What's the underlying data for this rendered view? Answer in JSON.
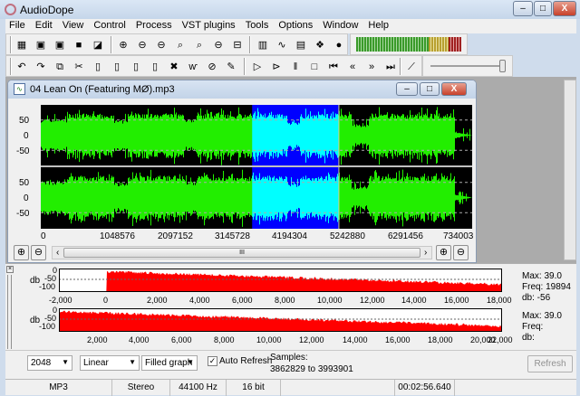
{
  "app": {
    "title": "AudioDope",
    "minimize": "–",
    "maximize": "□",
    "close": "X"
  },
  "menu": [
    "File",
    "Edit",
    "View",
    "Control",
    "Process",
    "VST plugins",
    "Tools",
    "Options",
    "Window",
    "Help"
  ],
  "toolbar1": [
    {
      "icon": "new-file-icon",
      "g": "▦"
    },
    {
      "icon": "open-icon",
      "g": "▣"
    },
    {
      "icon": "close-file-icon",
      "g": "▣"
    },
    {
      "icon": "save-icon",
      "g": "■"
    },
    {
      "icon": "save-as-icon",
      "g": "◪"
    },
    {
      "icon": "zoom-in-icon",
      "g": "⊕"
    },
    {
      "icon": "zoom-out-icon",
      "g": "⊖"
    },
    {
      "icon": "zoom-out-2-icon",
      "g": "⊖"
    },
    {
      "icon": "zoom-selection-icon",
      "g": "⌕"
    },
    {
      "icon": "zoom-fit-icon",
      "g": "⌕"
    },
    {
      "icon": "zoom-prev-icon",
      "g": "⊖"
    },
    {
      "icon": "fit-width-icon",
      "g": "⊟"
    },
    {
      "icon": "spectrum-icon",
      "g": "▥"
    },
    {
      "icon": "waveform-icon",
      "g": "∿"
    },
    {
      "icon": "vst-icon",
      "g": "▤"
    },
    {
      "icon": "plugin-icon",
      "g": "❖"
    },
    {
      "icon": "info-icon",
      "g": "●"
    }
  ],
  "toolbar2": [
    {
      "icon": "undo-icon",
      "g": "↶"
    },
    {
      "icon": "redo-icon",
      "g": "↷"
    },
    {
      "icon": "copy-icon",
      "g": "⧉"
    },
    {
      "icon": "cut-icon",
      "g": "✂"
    },
    {
      "icon": "paste-icon",
      "g": "▯"
    },
    {
      "icon": "paste-mix-icon",
      "g": "▯"
    },
    {
      "icon": "paste-new-icon",
      "g": "▯"
    },
    {
      "icon": "paste-insert-icon",
      "g": "▯"
    },
    {
      "icon": "delete-icon",
      "g": "✖"
    },
    {
      "icon": "silence-icon",
      "g": "ⱳ"
    },
    {
      "icon": "clear-icon",
      "g": "⊘"
    },
    {
      "icon": "edit-icon",
      "g": "✎"
    },
    {
      "icon": "play-icon",
      "g": "▷"
    },
    {
      "icon": "play-selection-icon",
      "g": "⊳"
    },
    {
      "icon": "pause-icon",
      "g": "‖"
    },
    {
      "icon": "stop-icon",
      "g": "□"
    },
    {
      "icon": "skip-start-icon",
      "g": "⏮"
    },
    {
      "icon": "rewind-icon",
      "g": "«"
    },
    {
      "icon": "fast-forward-icon",
      "g": "»"
    },
    {
      "icon": "skip-end-icon",
      "g": "⏭"
    },
    {
      "icon": "record-mic-icon",
      "g": "⟋"
    }
  ],
  "volume_slider": {
    "value": 1.0
  },
  "document": {
    "title": "04 Lean On (Featuring MØ).mp3",
    "y_ticks": [
      "50",
      "0",
      "-50"
    ],
    "x_ticks": [
      "0",
      "1048576",
      "2097152",
      "3145728",
      "4194304",
      "5242880",
      "6291456",
      "734003"
    ],
    "selection_start_fraction": 0.49,
    "selection_end_fraction": 0.69,
    "scroll_thumb_label": "III",
    "colors": {
      "wave": "#22ee00",
      "selection_bg": "#0000ff",
      "selection_wave": "#00ffff",
      "background": "#000000"
    }
  },
  "spectrum": {
    "db_label": "db",
    "y_ticks": [
      "0",
      "-50",
      "-100"
    ],
    "top": {
      "x_ticks": [
        "-2,000",
        "0",
        "2,000",
        "4,000",
        "6,000",
        "8,000",
        "10,000",
        "12,000",
        "14,000",
        "16,000",
        "18,000"
      ],
      "max": "Max: 39.0",
      "freq": "Freq: 19894",
      "db": "db: -56"
    },
    "bottom": {
      "x_ticks": [
        "2,000",
        "4,000",
        "6,000",
        "8,000",
        "10,000",
        "12,000",
        "14,000",
        "16,000",
        "18,000",
        "20,000",
        "22,000"
      ],
      "max": "Max: 39.0",
      "freq": "Freq:",
      "db": "db:"
    },
    "color": "#ff0000"
  },
  "controls": {
    "fft_size": "2048",
    "scale": "Linear",
    "graph": "Filled graph",
    "auto_refresh_label": "Auto Refresh",
    "auto_refresh": true,
    "samples_label": "Samples:",
    "samples_range": "3862829 to 3993901",
    "refresh": "Refresh"
  },
  "status": {
    "format": "MP3",
    "channels": "Stereo",
    "rate": "44100 Hz",
    "bits": "16 bit",
    "empty": "",
    "time": "00:02:56.640"
  }
}
